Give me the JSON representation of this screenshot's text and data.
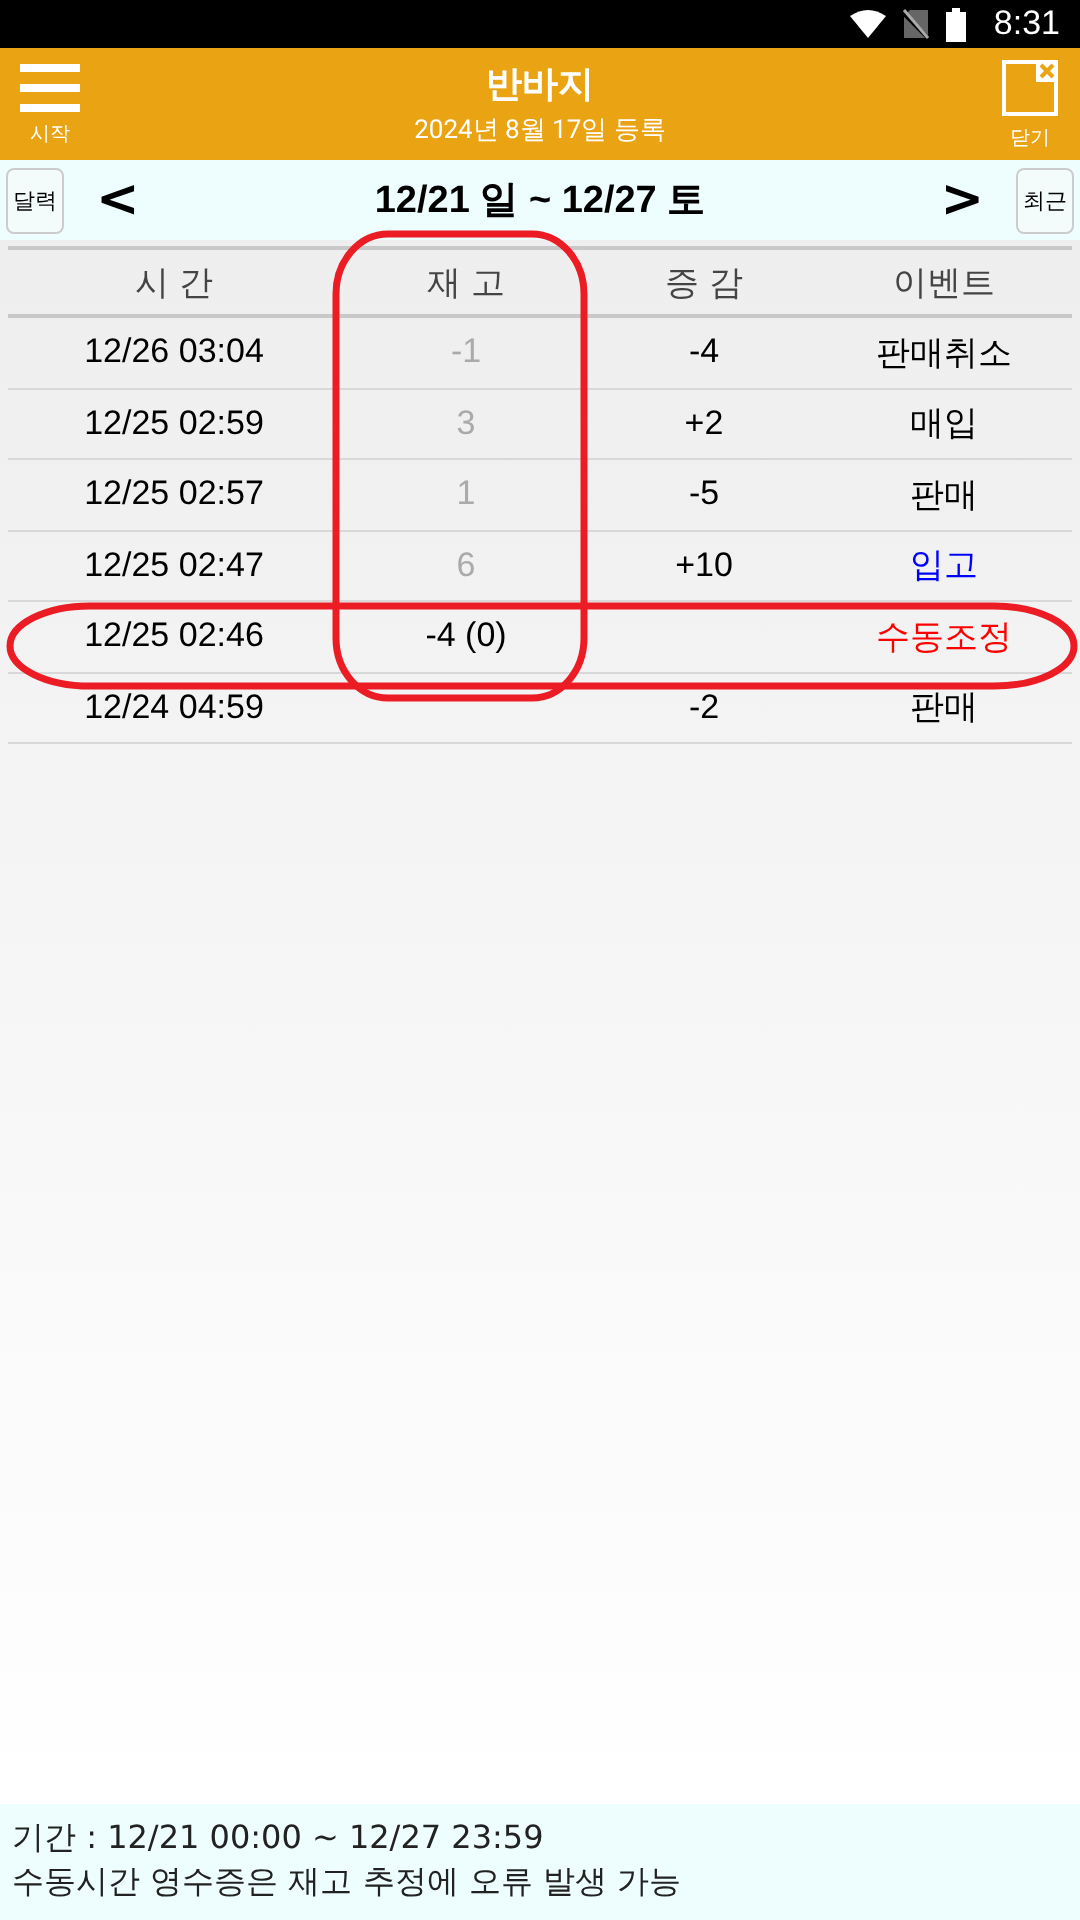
{
  "status_bar": {
    "time": "8:31"
  },
  "header": {
    "menu_label": "시작",
    "title": "반바지",
    "subtitle": "2024년 8월 17일 등록",
    "close_label": "닫기"
  },
  "nav": {
    "calendar_button": "달력",
    "prev": "<",
    "range": "12/21 일 ~ 12/27 토",
    "next": ">",
    "recent_button": "최근"
  },
  "table": {
    "columns": [
      "시 간",
      "재  고",
      "증 감",
      "이벤트"
    ],
    "rows": [
      {
        "time": "12/26 03:04",
        "stock": "-1",
        "stock_dimmed": true,
        "change": "-4",
        "event": "판매취소",
        "color": "#000000"
      },
      {
        "time": "12/25 02:59",
        "stock": "3",
        "stock_dimmed": true,
        "change": "+2",
        "event": "매입",
        "color": "#000000"
      },
      {
        "time": "12/25 02:57",
        "stock": "1",
        "stock_dimmed": true,
        "change": "-5",
        "event": "판매",
        "color": "#000000"
      },
      {
        "time": "12/25 02:47",
        "stock": "6",
        "stock_dimmed": true,
        "change": "+10",
        "event": "입고",
        "color": "#0000ff"
      },
      {
        "time": "12/25 02:46",
        "stock": "-4 (0)",
        "stock_dimmed": false,
        "change": "",
        "event": "수동조정",
        "color": "#ff0000"
      },
      {
        "time": "12/24 04:59",
        "stock": "",
        "change": "-2",
        "event": "판매",
        "color": "#000000"
      }
    ]
  },
  "annotations": {
    "stock_column_outlined": true,
    "manual_row_outlined": true
  },
  "footer": {
    "period": "기간 : 12/21 00:00 ~ 12/27 23:59",
    "note": "수동시간 영수증은 재고 추정에 오류 발생 가능"
  }
}
